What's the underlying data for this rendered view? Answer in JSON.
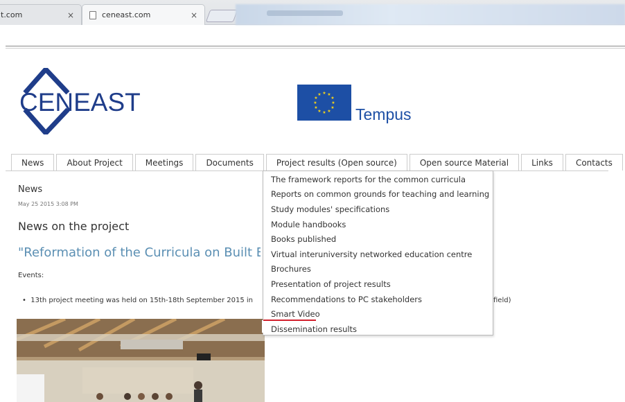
{
  "browser": {
    "tab1_title": "t.com",
    "tab2_title": "ceneast.com",
    "close_glyph": "×"
  },
  "logo": {
    "text": "CENEAST"
  },
  "partner": {
    "text": "Tempus"
  },
  "nav": [
    "News",
    "About Project",
    "Meetings",
    "Documents",
    "Project results (Open source)",
    "Open source Material",
    "Links",
    "Contacts"
  ],
  "dropdown": [
    "The framework reports for the common curricula",
    "Reports on common grounds for teaching and learning",
    "Study modules' specifications",
    "Module handbooks",
    "Books published",
    "Virtual interuniversity networked education centre",
    "Brochures",
    "Presentation of project results",
    "Recommendations to PC stakeholders",
    "Smart Video",
    "Dissemination results"
  ],
  "content": {
    "section_heading": "News",
    "date": "May 25 2015 3:08 PM",
    "news_title": "News on the project",
    "article_title": "\"Reformation of the Curricula on Built Environment",
    "events_label": "Events:",
    "bullet_text": "13th project meeting was held on 15th-18th September 2015 in",
    "bullet_tail": "field)"
  },
  "colors": {
    "brand_blue": "#1f3d8a",
    "eu_blue": "#1d4fa5",
    "link_blue": "#5b8fb3",
    "highlight_red": "#d21f2b"
  }
}
